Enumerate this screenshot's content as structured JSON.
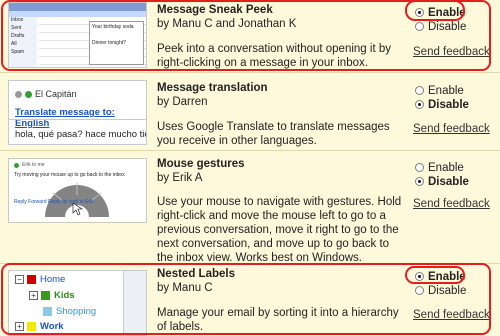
{
  "labs": [
    {
      "title": "Message Sneak Peek",
      "author": "by Manu C and Jonathan K",
      "description": "Peek into a conversation without opening it by right-clicking on a message in your inbox.",
      "options": {
        "enable": "Enable",
        "disable": "Disable"
      },
      "selected": "enable",
      "feedback": "Send feedback",
      "preview": {
        "list_items": [
          "Inbox",
          "Sent",
          "Drafts",
          "All",
          "Spam"
        ],
        "popup_title": "Your birthday soda",
        "popup_line2": "Dinner tonight?"
      }
    },
    {
      "title": "Message translation",
      "author": "by Darren",
      "description": "Uses Google Translate to translate messages you receive in other languages.",
      "options": {
        "enable": "Enable",
        "disable": "Disable"
      },
      "selected": "disable",
      "feedback": "Send feedback",
      "preview": {
        "sender": "El Capitán",
        "link": "Translate message to: English",
        "message": "hola, qué pasa? hace mucho tiempo"
      }
    },
    {
      "title": "Mouse gestures",
      "author": "by Erik A",
      "description": "Use your mouse to navigate with gestures. Hold right-click and move the mouse left to go to a previous conversation, move it right to go to the next conversation, and move up to go back to the inbox view. Works best on Windows.",
      "options": {
        "enable": "Enable",
        "disable": "Disable"
      },
      "selected": "disable",
      "feedback": "Send feedback",
      "preview": {
        "sender": "Erik to me",
        "line": "Try moving your mouse up to go back to the inbox",
        "reply": "Reply  Forward  Reply by chat to Erik"
      }
    },
    {
      "title": "Nested Labels",
      "author": "by Manu C",
      "description": "Manage your email by sorting it into a hierarchy of labels.",
      "options": {
        "enable": "Enable",
        "disable": "Disable"
      },
      "selected": "enable",
      "feedback": "Send feedback",
      "preview": {
        "home": "Home",
        "kids": "Kids",
        "shopping": "Shopping",
        "work": "Work"
      }
    }
  ],
  "colors": {
    "highlight": "#e31e1e",
    "background": "#fff9db",
    "link": "#1a55c2"
  }
}
